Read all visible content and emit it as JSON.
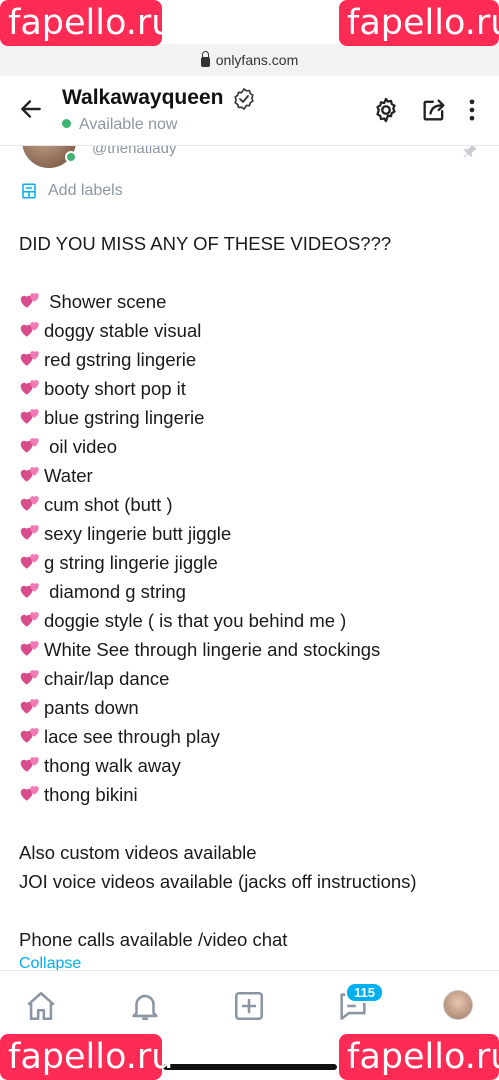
{
  "watermarks": {
    "top_left": "fapello.ru",
    "top_right": "fapello.ru",
    "bottom_left": "fapello.ru",
    "bottom_right": "fapello.ru"
  },
  "browser": {
    "url": "onlyfans.com"
  },
  "header": {
    "title": "Walkawayqueen",
    "status": "Available now",
    "handle": "@thenatlady"
  },
  "labels": {
    "text": "Add labels"
  },
  "post": {
    "lines": [
      {
        "text": "DID YOU MISS ANY OF THESE VIDEOS???",
        "heart": false
      },
      {
        "text": "",
        "heart": false
      },
      {
        "text": " Shower scene",
        "heart": true
      },
      {
        "text": "doggy stable visual",
        "heart": true
      },
      {
        "text": "red gstring lingerie",
        "heart": true
      },
      {
        "text": "booty short pop it",
        "heart": true
      },
      {
        "text": "blue gstring lingerie",
        "heart": true
      },
      {
        "text": " oil video",
        "heart": true
      },
      {
        "text": "Water",
        "heart": true
      },
      {
        "text": "cum shot (butt )",
        "heart": true
      },
      {
        "text": "sexy lingerie butt jiggle",
        "heart": true
      },
      {
        "text": "g string lingerie jiggle",
        "heart": true
      },
      {
        "text": " diamond g string",
        "heart": true
      },
      {
        "text": "doggie style ( is that you behind me )",
        "heart": true
      },
      {
        "text": "White See through lingerie and stockings",
        "heart": true
      },
      {
        "text": "chair/lap dance",
        "heart": true
      },
      {
        "text": "pants down",
        "heart": true
      },
      {
        "text": "lace see through play",
        "heart": true
      },
      {
        "text": "thong walk away",
        "heart": true
      },
      {
        "text": "thong bikini",
        "heart": true
      },
      {
        "text": "",
        "heart": false
      },
      {
        "text": "Also custom videos available",
        "heart": false
      },
      {
        "text": "JOI voice videos available (jacks off instructions)",
        "heart": false
      },
      {
        "text": "",
        "heart": false
      },
      {
        "text": "Phone calls available /video chat",
        "heart": false
      }
    ],
    "collapse_label": "Collapse"
  },
  "bottom_nav": {
    "items": [
      {
        "name": "home",
        "icon": "home-icon"
      },
      {
        "name": "notifications",
        "icon": "bell-icon"
      },
      {
        "name": "new-post",
        "icon": "plus-square-icon"
      },
      {
        "name": "messages",
        "icon": "message-icon"
      },
      {
        "name": "profile",
        "icon": "avatar"
      }
    ],
    "messages_badge": "115"
  },
  "colors": {
    "accent": "#00aff0",
    "online": "#3cb371",
    "heart": "#e8589a",
    "watermark": "#fe2c55",
    "muted": "#8a96a3"
  }
}
